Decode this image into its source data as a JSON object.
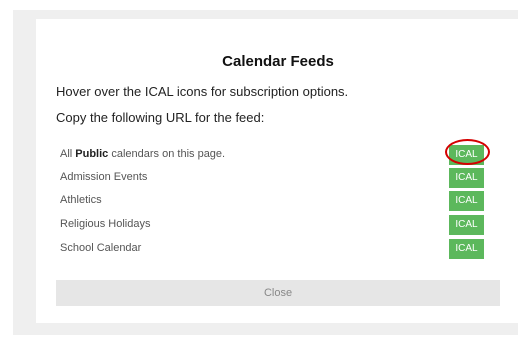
{
  "modal": {
    "title": "Calendar Feeds",
    "instruction_hover": "Hover over the ICAL icons for subscription options.",
    "instruction_copy": "Copy the following URL for the feed:",
    "close_label": "Close"
  },
  "feeds": [
    {
      "label_prefix": "All ",
      "label_bold": "Public",
      "label_suffix": " calendars on this page.",
      "button": "ICAL"
    },
    {
      "label": "Admission Events",
      "button": "ICAL"
    },
    {
      "label": "Athletics",
      "button": "ICAL"
    },
    {
      "label": "Religious Holidays",
      "button": "ICAL"
    },
    {
      "label": "School Calendar",
      "button": "ICAL"
    }
  ],
  "colors": {
    "ical_button": "#5cb85c",
    "highlight_ring": "#d40000",
    "backdrop": "#efefef",
    "close_button": "#e6e6e6"
  }
}
